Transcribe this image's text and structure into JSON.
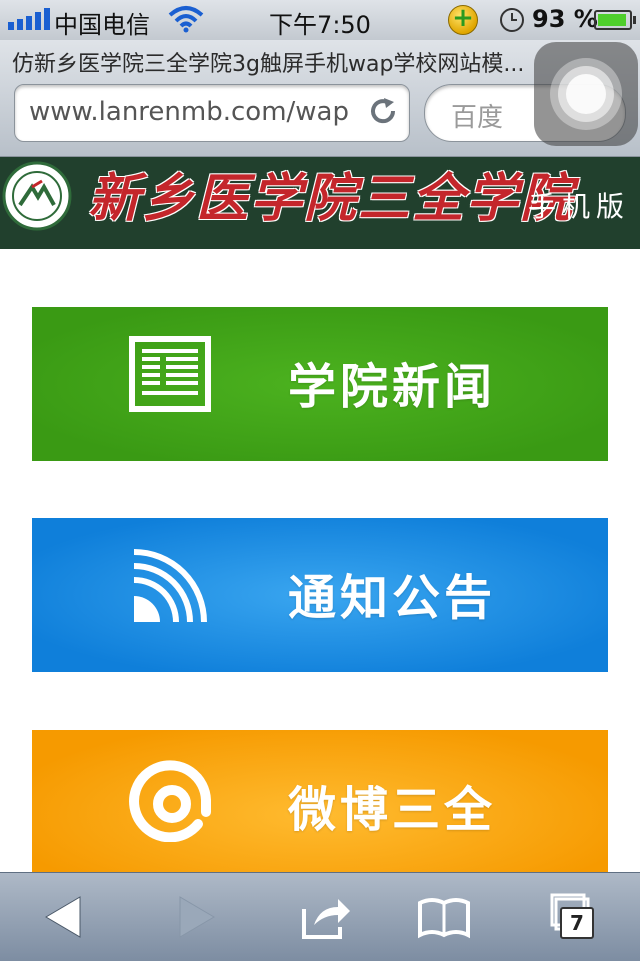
{
  "status_bar": {
    "carrier": "中国电信",
    "time": "下午7:50",
    "battery": "93 %"
  },
  "browser": {
    "page_title": "仿新乡医学院三全学院3g触屏手机wap学校网站模...",
    "url": "www.lanrenmb.com/wap",
    "search_placeholder": "百度",
    "tab_count": "7"
  },
  "site": {
    "name": "新乡医学院三全学院",
    "subtitle": "手机版"
  },
  "menu": [
    {
      "label": "学院新闻",
      "icon": "news-icon",
      "color": "#3d9e16"
    },
    {
      "label": "通知公告",
      "icon": "rss-icon",
      "color": "#1283dc"
    },
    {
      "label": "微博三全",
      "icon": "at-icon",
      "color": "#f7a00a"
    }
  ],
  "colors": {
    "header_bg": "#21402d",
    "site_name": "#c4262b"
  }
}
